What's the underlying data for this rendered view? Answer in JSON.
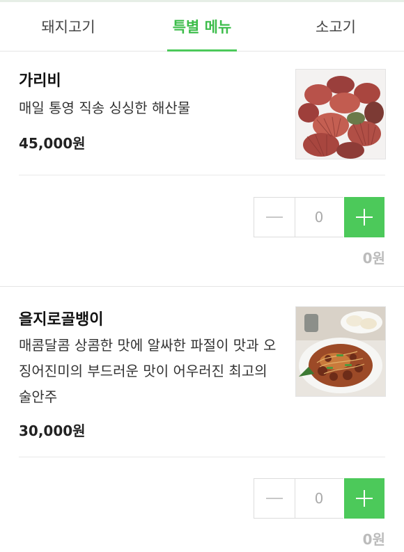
{
  "tabs": [
    {
      "label": "돼지고기",
      "active": false
    },
    {
      "label": "특별 메뉴",
      "active": true
    },
    {
      "label": "소고기",
      "active": false
    }
  ],
  "colors": {
    "accent": "#4cc95a",
    "active_tab_text": "#3dbd4b"
  },
  "items": [
    {
      "name": "가리비",
      "description": "매일 통영 직송 싱싱한 해산물",
      "price": "45,000원",
      "quantity": "0",
      "line_total": "0원",
      "image": "scallops-photo"
    },
    {
      "name": "을지로골뱅이",
      "description": "매콤달콤 상콤한 맛에 알싸한 파절이 맛과 오징어진미의 부드러운 맛이 어우러진 최고의 술안주",
      "price": "30,000원",
      "quantity": "0",
      "line_total": "0원",
      "image": "golbaengi-dish-photo"
    }
  ]
}
